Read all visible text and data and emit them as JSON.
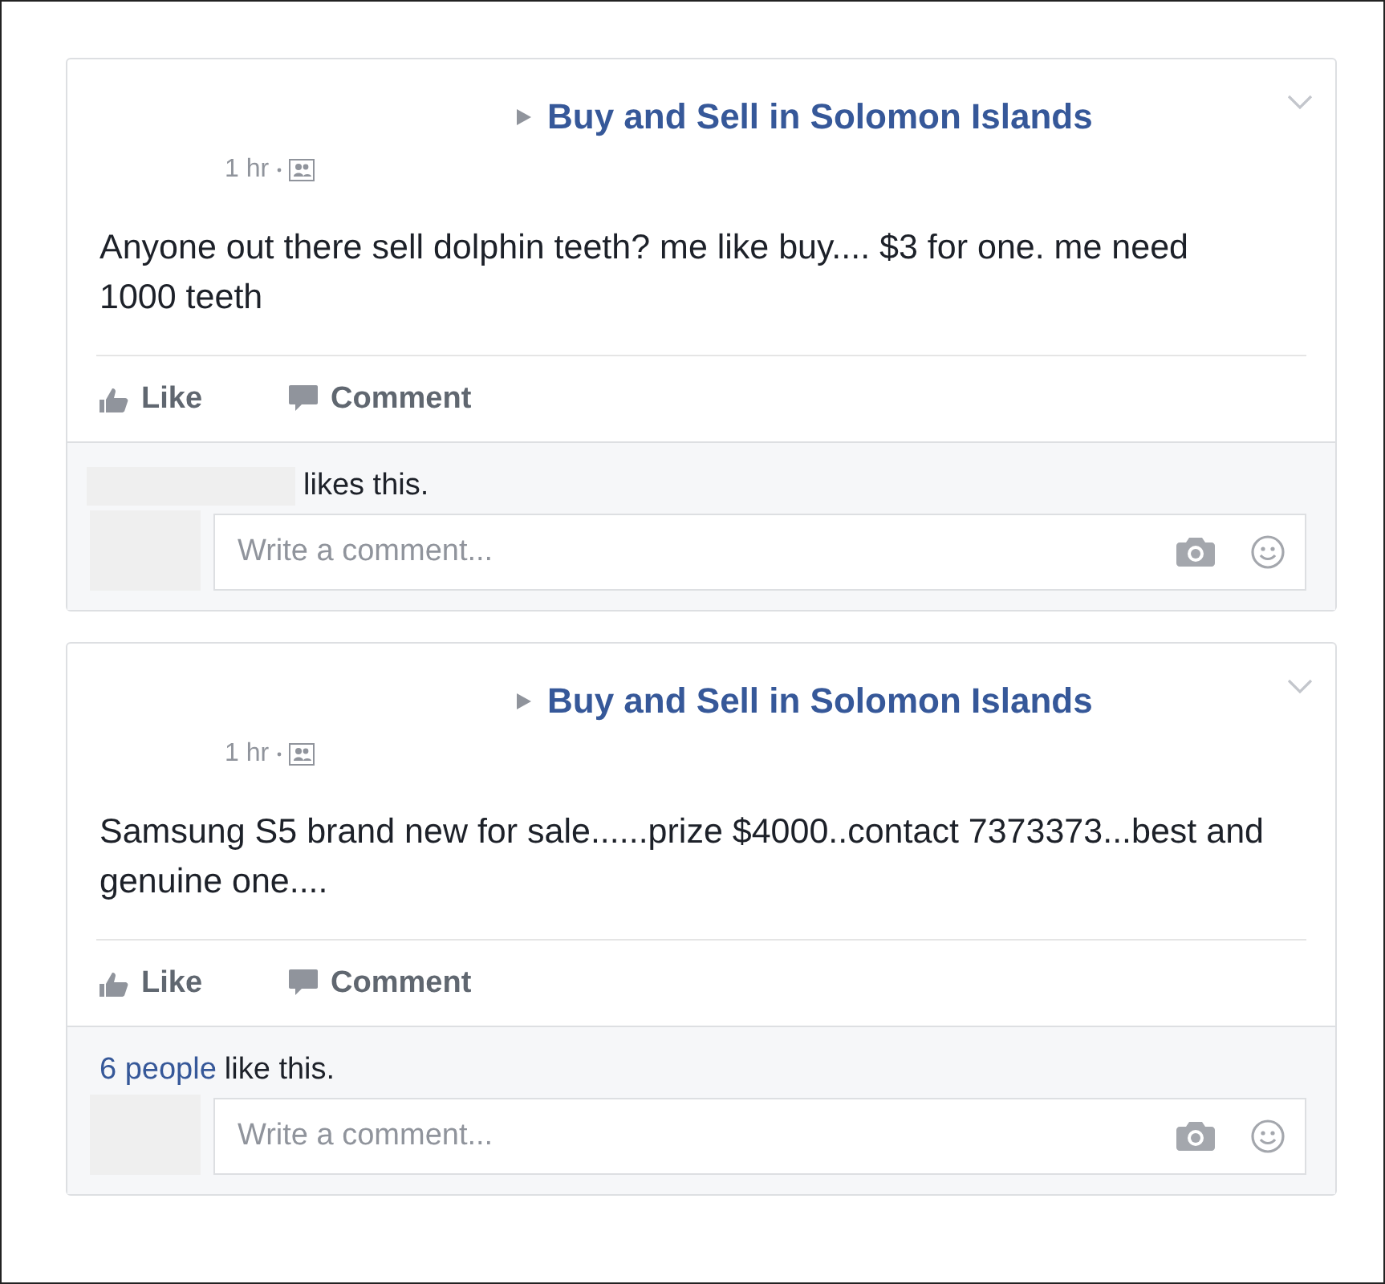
{
  "posts": [
    {
      "group": "Buy and Sell in Solomon Islands",
      "time": "1 hr",
      "text": "Anyone out there sell dolphin teeth? me like buy.... $3 for one. me need 1000 teeth",
      "actions": [
        "Like",
        "Comment"
      ],
      "likes": {
        "text": "likes this."
      },
      "comment_placeholder": "Write a comment..."
    },
    {
      "group": "Buy and Sell in Solomon Islands",
      "time": "1 hr",
      "text": "Samsung S5 brand new for sale......prize $4000..contact 7373373...best and genuine one....",
      "actions": [
        "Like",
        "Comment"
      ],
      "likes": {
        "link": "6 people",
        "text": "like this."
      },
      "comment_placeholder": "Write a comment..."
    }
  ]
}
